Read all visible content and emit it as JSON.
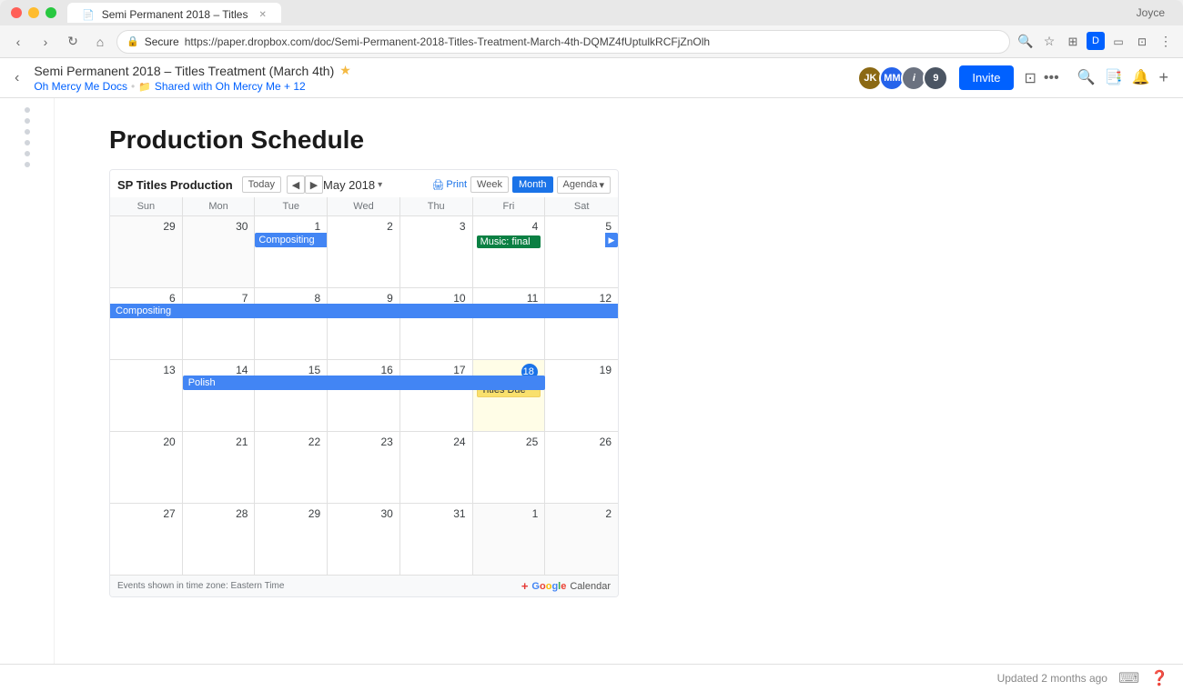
{
  "browser": {
    "tab_title": "Semi Permanent 2018 – Titles",
    "url": "https://paper.dropbox.com/doc/Semi-Permanent-2018-Titles-Treatment-March-4th-DQMZ4fUptulkRCFjZnOlh",
    "user": "Joyce"
  },
  "toolbar": {
    "doc_title": "Semi Permanent 2018 – Titles Treatment (March 4th)",
    "star_label": "★",
    "breadcrumb_root": "Oh Mercy Me Docs",
    "breadcrumb_sep": "•",
    "breadcrumb_folder": "Shared with Oh Mercy Me + 12",
    "invite_label": "Invite",
    "avatars": [
      {
        "initials": "JK",
        "color": "#8B6914"
      },
      {
        "initials": "MM",
        "color": "#2563eb"
      },
      {
        "initials": "i",
        "color": "#6b7280"
      },
      {
        "initials": "9",
        "color": "#4b5563"
      }
    ]
  },
  "document": {
    "heading": "Production Schedule",
    "calendar_title": "SP Titles Production"
  },
  "calendar": {
    "month": "May 2018",
    "view_buttons": [
      "Print",
      "Week",
      "Month",
      "Agenda"
    ],
    "active_view": "Month",
    "today_btn": "Today",
    "days": [
      "Sun",
      "Mon",
      "Tue",
      "Wed",
      "Thu",
      "Fri",
      "Sat"
    ],
    "weeks": [
      {
        "dates": [
          {
            "num": "29",
            "other": true,
            "events": []
          },
          {
            "num": "30",
            "other": true,
            "events": []
          },
          {
            "num": "1 May",
            "events": [
              {
                "label": "Compositing",
                "type": "blue-span",
                "span": 7
              }
            ]
          },
          {
            "num": "2",
            "events": []
          },
          {
            "num": "3",
            "events": []
          },
          {
            "num": "4",
            "events": [
              {
                "label": "Music: final",
                "type": "green"
              }
            ]
          },
          {
            "num": "5",
            "events": [
              {
                "type": "arrow"
              }
            ]
          }
        ]
      },
      {
        "dates": [
          {
            "num": "6",
            "events": []
          },
          {
            "num": "7",
            "events": []
          },
          {
            "num": "8",
            "events": []
          },
          {
            "num": "9",
            "events": []
          },
          {
            "num": "10",
            "events": []
          },
          {
            "num": "11",
            "events": []
          },
          {
            "num": "12",
            "events": []
          }
        ],
        "span_events": [
          {
            "label": "Compositing",
            "type": "blue",
            "start": 0,
            "end": 6
          }
        ]
      },
      {
        "dates": [
          {
            "num": "13",
            "events": []
          },
          {
            "num": "14",
            "events": [
              {
                "label": "Polish",
                "type": "blue-span",
                "span": 5
              }
            ]
          },
          {
            "num": "15",
            "events": []
          },
          {
            "num": "16",
            "events": []
          },
          {
            "num": "17",
            "events": []
          },
          {
            "num": "18",
            "today": true,
            "events": [
              {
                "label": "Titles Due",
                "type": "yellow"
              }
            ]
          },
          {
            "num": "19",
            "events": []
          }
        ]
      },
      {
        "dates": [
          {
            "num": "20",
            "events": []
          },
          {
            "num": "21",
            "events": []
          },
          {
            "num": "22",
            "events": []
          },
          {
            "num": "23",
            "events": []
          },
          {
            "num": "24",
            "events": []
          },
          {
            "num": "25",
            "events": []
          },
          {
            "num": "26",
            "events": []
          }
        ]
      },
      {
        "dates": [
          {
            "num": "27",
            "events": []
          },
          {
            "num": "28",
            "events": []
          },
          {
            "num": "29",
            "events": []
          },
          {
            "num": "30",
            "events": []
          },
          {
            "num": "31",
            "events": []
          },
          {
            "num": "1 Jun",
            "other": true,
            "events": []
          },
          {
            "num": "2",
            "other": true,
            "events": []
          }
        ]
      }
    ],
    "footer_text": "Events shown in time zone: Eastern Time",
    "footer_google": "Google Calendar"
  },
  "status_bar": {
    "updated": "Updated 2 months ago"
  },
  "icons": {
    "back": "‹",
    "forward": "›",
    "refresh": "↻",
    "home": "⌂",
    "lock": "🔒",
    "star": "☆",
    "ext": "⊞",
    "cast": "▭",
    "menu": "⋮",
    "share": "⊡",
    "bell": "🔔",
    "plus": "+",
    "search": "🔍",
    "print": "🖨",
    "chevron_down": "▾",
    "chevron_left": "◀",
    "chevron_right": "▶"
  }
}
